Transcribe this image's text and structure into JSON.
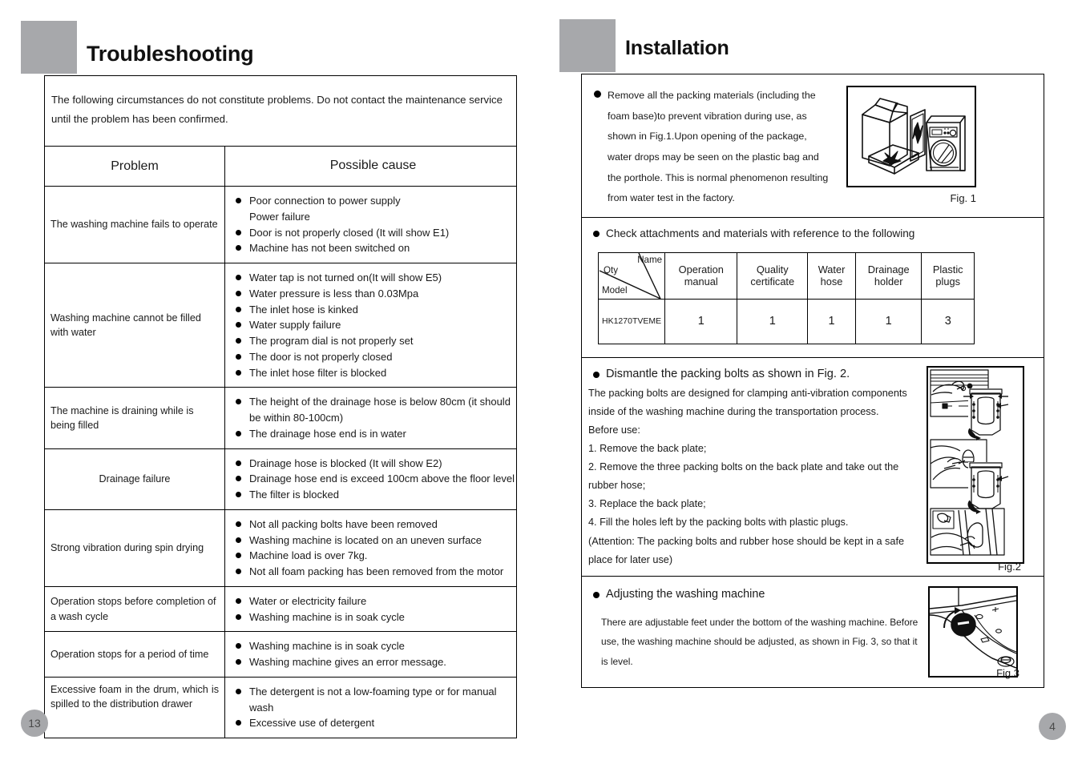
{
  "colors": {
    "accent_gray": "#a7a8ab",
    "ink": "#1a1a1a",
    "rule": "#000000"
  },
  "left_page": {
    "heading": "Troubleshooting",
    "page_number": "13",
    "intro": "The following circumstances do not constitute problems. Do not contact the maintenance service until the problem has been confirmed.",
    "table": {
      "headers": [
        "Problem",
        "Possible cause"
      ],
      "rows": [
        {
          "problem": "The washing machine fails to operate",
          "align": "left",
          "causes": [
            {
              "text": "Poor connection to power supply",
              "bullet": true
            },
            {
              "text": "Power failure",
              "bullet": false
            },
            {
              "text": "Door is not properly closed (It will show E1)",
              "bullet": true
            },
            {
              "text": "Machine has not been switched on",
              "bullet": true
            }
          ]
        },
        {
          "problem": "Washing machine cannot be filled with water",
          "align": "left",
          "causes": [
            {
              "text": "Water tap is not turned on(It will show E5)",
              "bullet": true
            },
            {
              "text": "Water pressure is less than 0.03Mpa",
              "bullet": true
            },
            {
              "text": "The inlet hose is kinked",
              "bullet": true
            },
            {
              "text": "Water supply failure",
              "bullet": true
            },
            {
              "text": "The program dial is not properly set",
              "bullet": true
            },
            {
              "text": "The door is not properly closed",
              "bullet": true
            },
            {
              "text": "The inlet hose filter is blocked",
              "bullet": true
            }
          ]
        },
        {
          "problem": "The machine is draining while is being filled",
          "align": "left",
          "causes": [
            {
              "text": "The height of the drainage hose is below 80cm (it should be within 80-100cm)",
              "bullet": true
            },
            {
              "text": "The drainage hose end is in water",
              "bullet": true
            }
          ]
        },
        {
          "problem": "Drainage failure",
          "align": "center",
          "causes": [
            {
              "text": "Drainage hose is blocked (It will show E2)",
              "bullet": true
            },
            {
              "text": "Drainage hose end is exceed 100cm above the floor level",
              "bullet": true
            },
            {
              "text": "The filter is blocked",
              "bullet": true
            }
          ]
        },
        {
          "problem": "Strong vibration during spin drying",
          "align": "left",
          "causes": [
            {
              "text": "Not all packing bolts have been removed",
              "bullet": true
            },
            {
              "text": "Washing machine is located on an uneven surface",
              "bullet": true
            },
            {
              "text": "Machine load is over 7kg.",
              "bullet": true
            },
            {
              "text": "Not all foam packing has been removed from the motor",
              "bullet": true
            }
          ]
        },
        {
          "problem": "Operation stops before completion of a wash cycle",
          "align": "left",
          "causes": [
            {
              "text": "Water or electricity failure",
              "bullet": true
            },
            {
              "text": "Washing machine is in soak cycle",
              "bullet": true
            }
          ]
        },
        {
          "problem": "Operation stops for a period of time",
          "align": "left",
          "causes": [
            {
              "text": "Washing machine is in soak cycle",
              "bullet": true
            },
            {
              "text": "Washing machine gives an error message.",
              "bullet": true
            }
          ]
        },
        {
          "problem": "Excessive foam in the drum, which is spilled to the distribution drawer",
          "align": "justify",
          "causes": [
            {
              "text": "The detergent is not a low-foaming type or for manual wash",
              "bullet": true
            },
            {
              "text": "Excessive use of detergent",
              "bullet": true
            }
          ]
        }
      ]
    }
  },
  "right_page": {
    "heading": "Installation",
    "page_number": "4",
    "section_remove_packing": {
      "text": "Remove all the packing materials (including the foam base)to prevent vibration during use, as shown in Fig.1.Upon opening of the package, water drops may be seen on the plastic bag and the porthole. This is normal phenomenon resulting from water test in the factory.",
      "figure_caption": "Fig. 1",
      "figure_name": "packing-box-and-washer-illustration"
    },
    "section_attachments": {
      "heading": "Check attachments and materials with reference to the following",
      "corner_labels": {
        "name": "Name",
        "qty": "Qty",
        "model": "Model"
      },
      "columns": [
        "Operation manual",
        "Quality certificate",
        "Water hose",
        "Drainage holder",
        "Plastic plugs"
      ],
      "rows": [
        {
          "model": "HK1270TVEME",
          "quantities": [
            "1",
            "1",
            "1",
            "1",
            "3"
          ]
        }
      ]
    },
    "section_bolts": {
      "heading": "Dismantle the packing bolts as shown in Fig. 2.",
      "paragraphs": [
        "The packing bolts are designed for clamping anti-vibration  components inside of the washing machine during the  transportation process.",
        "Before use:",
        "1. Remove the back plate;",
        "2. Remove the three packing bolts on the back plate and take  out the rubber hose;",
        "3. Replace the back plate;",
        "4. Fill the holes left by the packing bolts with plastic plugs.",
        "(Attention: The packing bolts and rubber hose should be kept in a  safe place for later use)"
      ],
      "figure_caption": "Fig.2",
      "figure_name": "packing-bolt-removal-steps-illustration"
    },
    "section_adjusting": {
      "heading": "Adjusting the washing machine",
      "body": "There are adjustable feet under the bottom of the washing machine. Before use, the washing machine should be adjusted, as shown in Fig. 3, so that it is level.",
      "figure_caption": "Fig.3",
      "figure_name": "adjustable-foot-illustration"
    }
  }
}
